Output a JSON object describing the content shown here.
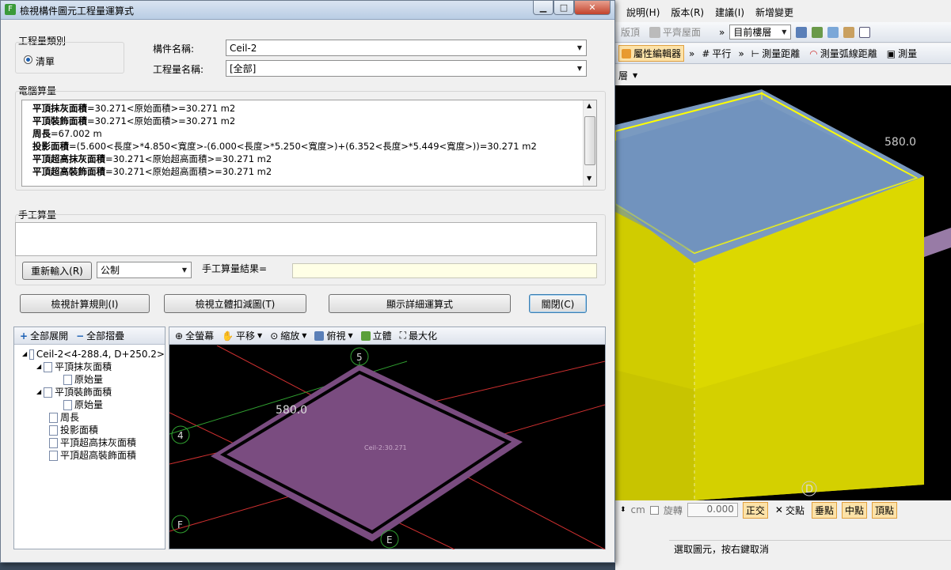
{
  "bg_app": {
    "menu": [
      "說明(H)",
      "版本(R)",
      "建議(I)",
      "新增變更"
    ],
    "toolbar1": {
      "partial_a": "版頂",
      "partial_b": "平齊屋面",
      "floor_combo": "目前樓層"
    },
    "toolbar2": {
      "prop_editor": "屬性編輯器",
      "parallel": "平行",
      "measure_dist": "測量距離",
      "measure_arc": "測量弧線距離",
      "measure_more": "測量"
    },
    "toolbar3": {
      "partial": "層"
    },
    "scene": {
      "dim_label": "580.0",
      "axis_d": "D"
    },
    "snapbar": {
      "unit": "cm",
      "rotate_label": "旋轉",
      "rotate_value": "0.000",
      "ortho": "正交",
      "intersect": "交點",
      "perp": "垂點",
      "mid": "中點",
      "vertex": "頂點"
    },
    "status_text": "選取圖元，按右鍵取消"
  },
  "dialog": {
    "title": "檢視構件圖元工程量運算式",
    "qty_type": {
      "label": "工程量類別",
      "option": "清單"
    },
    "component_name": {
      "label": "構件名稱:",
      "value": "Ceil-2"
    },
    "qty_name": {
      "label": "工程量名稱:",
      "value": "[全部]"
    },
    "computer_calc": {
      "label": "電腦算量",
      "lines": [
        {
          "name": "平頂抹灰面積",
          "expr": "=30.271<原始面積>=30.271 m2"
        },
        {
          "name": "平頂裝飾面積",
          "expr": "=30.271<原始面積>=30.271 m2"
        },
        {
          "name": "周長",
          "expr": "=67.002 m"
        },
        {
          "name": "投影面積",
          "expr": "=(5.600<長度>*4.850<寬度>-(6.000<長度>*5.250<寬度>)+(6.352<長度>*5.449<寬度>))=30.271 m2"
        },
        {
          "name": "平頂超高抹灰面積",
          "expr": "=30.271<原始超高面積>=30.271 m2"
        },
        {
          "name": "平頂超高裝飾面積",
          "expr": "=30.271<原始超高面積>=30.271 m2"
        }
      ]
    },
    "manual_calc": {
      "label": "手工算量",
      "reinput": "重新輸入(R)",
      "unit_combo": "公制",
      "result_label": "手工算量結果="
    },
    "buttons": {
      "view_rules": "檢視計算規則(I)",
      "view_3d": "檢視立體扣減圖(T)",
      "show_detail": "顯示詳細運算式",
      "close": "關閉(C)"
    },
    "tree": {
      "expand_all": "全部展開",
      "collapse_all": "全部摺疊",
      "root": "Ceil-2<4-288.4, D+250.2>",
      "items": [
        {
          "label": "平頂抹灰面積",
          "child": "原始量"
        },
        {
          "label": "平頂裝飾面積",
          "child": "原始量"
        },
        {
          "label": "周長"
        },
        {
          "label": "投影面積"
        },
        {
          "label": "平頂超高抹灰面積"
        },
        {
          "label": "平頂超高裝飾面積"
        }
      ]
    },
    "viewer": {
      "toolbar": {
        "full": "全螢幕",
        "pan": "平移",
        "zoom": "縮放",
        "top": "俯視",
        "solid": "立體",
        "max": "最大化"
      },
      "dim_label": "580.0",
      "shape_label": "Ceil-2:30.271",
      "axes": {
        "a5": "5",
        "a4": "4",
        "aF": "F",
        "aE": "E"
      }
    }
  }
}
